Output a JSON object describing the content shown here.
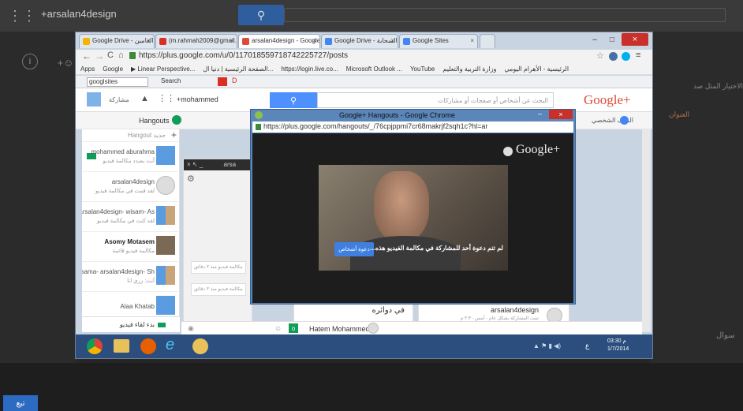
{
  "outer": {
    "search_value": "+arsalan4design",
    "bottom_button": "تبع",
    "right_edge_label": "سوال"
  },
  "browser": {
    "tabs": [
      {
        "label": "Google Drive - سؤال العامين",
        "color": "#f4b400"
      },
      {
        "label": "(m.rahmah2009@gmail.c",
        "color": "#d93025"
      },
      {
        "label": "arsalan4design - Google+",
        "color": "#dd4b39"
      },
      {
        "label": "Google Drive - ملفات السحابة",
        "color": "#4285f4"
      },
      {
        "label": "Google Sites",
        "color": "#4285f4"
      }
    ],
    "url": "https://plus.google.com/u/0/117018559718742225727/posts",
    "bookmarks": [
      "Apps",
      "Google",
      "▶ Linear Perspective...",
      "الصفحة الرئيسية | دنيا ال...",
      "https://login.live.co...",
      "Microsoft Outlook ...",
      "YouTube",
      "وزارة التربية والتعليم",
      "الرئيسية - الأهرام اليومي"
    ],
    "toolbar_search_value": "googlsites",
    "toolbar_search_label": "Search"
  },
  "gplus": {
    "share_label": "مشاركة",
    "user_label": "+mohammed",
    "search_placeholder": "البحث عن أشخاص أو صفحات أو مشاركات",
    "logo": "Google+",
    "profile_label": "الملف الشخصي",
    "hangouts_label": "Hangouts",
    "new_hangout": "Hangout جديد",
    "contacts": [
      {
        "name": "mohammed aburahma",
        "status": "أنت بصدد مكالمة فيديو"
      },
      {
        "name": "arsalan4design",
        "status": "لقد قمت في مكالمة فيديو"
      },
      {
        "name": "arsalan4design- wisam- As",
        "status": "لقد كنت في مكالمة فيديو"
      },
      {
        "name": "Asomy Motasem",
        "status": "مكالمة فيديو قائمة"
      },
      {
        "name": "osama- arsalan4design- Sh",
        "status": "أنت: زري انا"
      },
      {
        "name": "Alaa Khatab",
        "status": ""
      }
    ],
    "start_video": "بدء لقاء فيديو",
    "post_author": "arsalan4design",
    "post_meta": "تمت المشاركة بشكل عام - أمس ٢:٣٠ م",
    "circles_label": "في دوائره",
    "circle_member": "Hatem Mohammed",
    "left_heading": "الاختيار المثل صد",
    "left_badge": "العنوان",
    "chat_panel_label": "arsa",
    "call_note_1": "مكالمة فيديو منذ ٣ دقائق",
    "call_note_2": "مكالمة فيديو منذ ٣ دقائق"
  },
  "hangout": {
    "title": "Google+ Hangouts - Google Chrome",
    "url": "https://plus.google.com/hangouts/_/76cpjppmi7cr68makrjf2sqh1c?hl=ar",
    "logo": "Google+",
    "message": "لم تتم دعوة أحد للمشاركة في مكالمة الفيديو هذه...",
    "invite_button": "دعوة أشخاص"
  },
  "taskbar": {
    "time": "03:30 م",
    "date": "1/7/2014",
    "lang": "ع"
  }
}
